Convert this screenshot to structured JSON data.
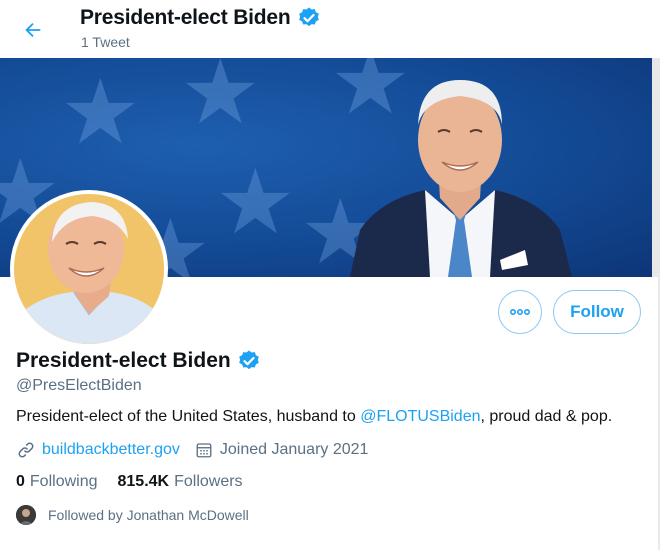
{
  "header": {
    "title": "President-elect Biden",
    "tweet_count": "1 Tweet"
  },
  "profile": {
    "display_name": "President-elect Biden",
    "handle": "@PresElectBiden",
    "bio_prefix": "President-elect of the United States, husband to ",
    "bio_mention": "@FLOTUSBiden",
    "bio_suffix": ", proud dad & pop.",
    "website": "buildbackbetter.gov",
    "joined": "Joined January 2021",
    "following_count": "0",
    "following_label": "Following",
    "followers_count": "815.4K",
    "followers_label": "Followers",
    "followed_by": "Followed by Jonathan McDowell"
  },
  "actions": {
    "follow_label": "Follow",
    "more_icon": "more-icon"
  },
  "colors": {
    "accent": "#1da1f2",
    "verified": "#1da1f2",
    "banner": "#134a95",
    "secondary_text": "#5b7083"
  }
}
